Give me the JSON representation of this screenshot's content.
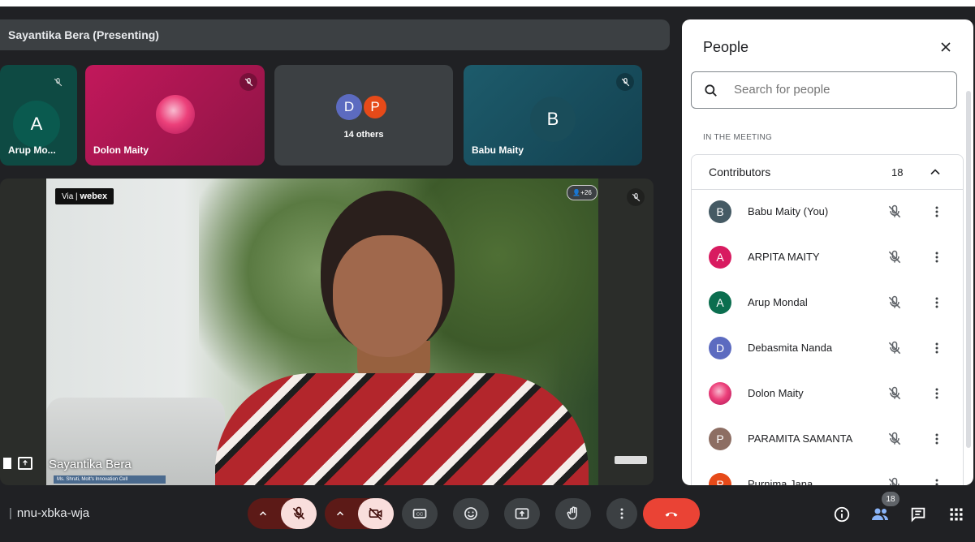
{
  "presenting_bar": {
    "title": "Sayantika Bera (Presenting)"
  },
  "tiles": [
    {
      "name": "Arup Mo...",
      "initial": "A",
      "color": "#0b5e52"
    },
    {
      "name": "Dolon Maity",
      "color": "#b3195a"
    },
    {
      "initials": [
        "D",
        "P"
      ],
      "others_label": "14 others"
    },
    {
      "name": "Babu Maity",
      "initial": "B",
      "color": "#1d5b6b"
    }
  ],
  "main_video": {
    "presenter_name": "Sayantika Bera",
    "webex_via": "Via",
    "webex_brand": "webex",
    "people_badge": "👤+26",
    "caption": "Ms. Shruti, Molt's Innovation Cell"
  },
  "toolbar": {
    "meeting_code": "nnu-xbka-wja",
    "people_count": "18"
  },
  "panel": {
    "title": "People",
    "search_placeholder": "Search for people",
    "section_label": "IN THE MEETING",
    "group_label": "Contributors",
    "group_count": "18",
    "participants": [
      {
        "name": "Babu Maity (You)",
        "initial": "B",
        "color": "#455a64"
      },
      {
        "name": "ARPITA MAITY",
        "initial": "A",
        "color": "#d81b60"
      },
      {
        "name": "Arup Mondal",
        "initial": "A",
        "color": "#0b6e4f"
      },
      {
        "name": "Debasmita Nanda",
        "initial": "D",
        "color": "#5c6bc0"
      },
      {
        "name": "Dolon Maity",
        "initial": "",
        "color": "#e57373"
      },
      {
        "name": "PARAMITA SAMANTA",
        "initial": "P",
        "color": "#8d6e63"
      },
      {
        "name": "Purnima Jana",
        "initial": "P",
        "color": "#e64a19"
      }
    ]
  }
}
